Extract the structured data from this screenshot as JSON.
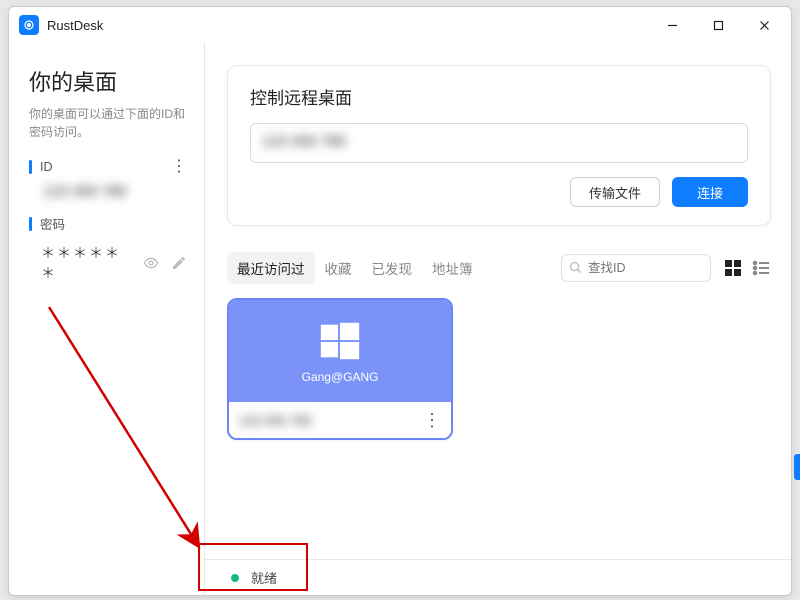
{
  "app": {
    "title": "RustDesk"
  },
  "sidebar": {
    "title": "你的桌面",
    "desc": "你的桌面可以通过下面的ID和密码访问。",
    "id_label": "ID",
    "id_value": "123 456 789",
    "pw_label": "密码",
    "pw_value": "＊＊＊＊＊＊"
  },
  "control": {
    "title": "控制远程桌面",
    "input_value": "123 456 789",
    "transfer": "传输文件",
    "connect": "连接"
  },
  "tabs": {
    "recent": "最近访问过",
    "fav": "收藏",
    "discovered": "已发现",
    "addressbook": "地址簿"
  },
  "search": {
    "placeholder": "查找ID"
  },
  "peer": {
    "name": "Gang@GANG",
    "id": "123 456 789"
  },
  "status": {
    "text": "就绪"
  }
}
